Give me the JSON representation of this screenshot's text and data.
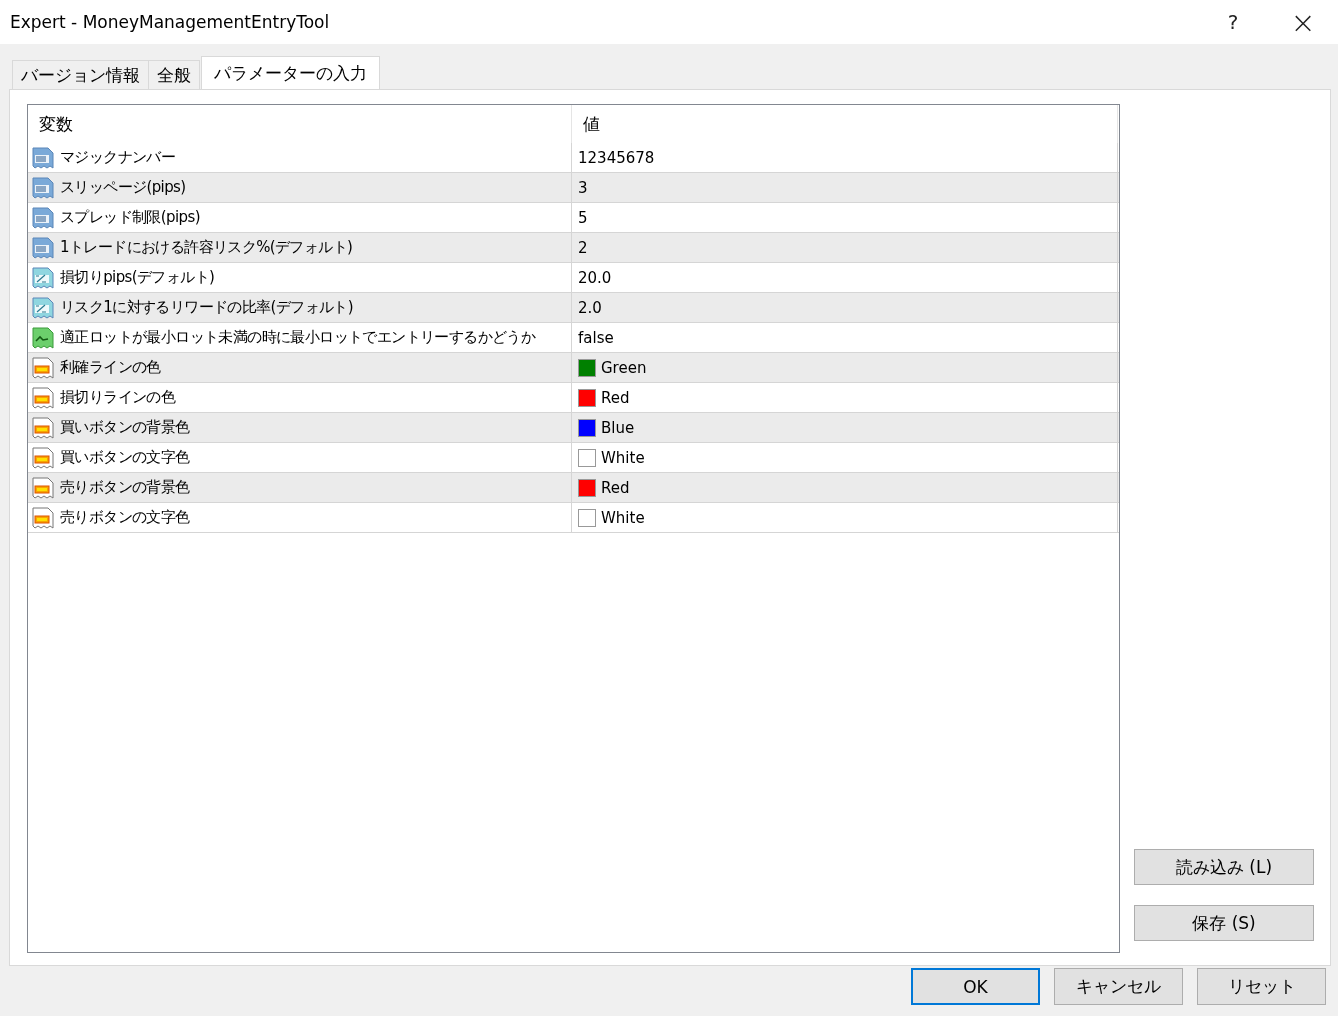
{
  "window": {
    "title": "Expert - MoneyManagementEntryTool",
    "help": "?",
    "close": "×"
  },
  "tabs": [
    {
      "label": "バージョン情報",
      "selected": false
    },
    {
      "label": "全般",
      "selected": false
    },
    {
      "label": "パラメーターの入力",
      "selected": true
    }
  ],
  "table": {
    "columns": [
      "変数",
      "値"
    ],
    "rows": [
      {
        "kind": "int",
        "name": "マジックナンバー",
        "value": "12345678"
      },
      {
        "kind": "int",
        "name": "スリッページ(pips)",
        "value": "3"
      },
      {
        "kind": "int",
        "name": "スプレッド制限(pips)",
        "value": "5"
      },
      {
        "kind": "int",
        "name": "1トレードにおける許容リスク%(デフォルト)",
        "value": "2"
      },
      {
        "kind": "double",
        "name": "損切りpips(デフォルト)",
        "value": "20.0"
      },
      {
        "kind": "double",
        "name": "リスク1に対するリワードの比率(デフォルト)",
        "value": "2.0"
      },
      {
        "kind": "bool",
        "name": "適正ロットが最小ロット未満の時に最小ロットでエントリーするかどうか",
        "value": "false"
      },
      {
        "kind": "color",
        "name": "利確ラインの色",
        "value": "Green",
        "color": "#008000"
      },
      {
        "kind": "color",
        "name": "損切りラインの色",
        "value": "Red",
        "color": "#ff0000"
      },
      {
        "kind": "color",
        "name": "買いボタンの背景色",
        "value": "Blue",
        "color": "#0000ff"
      },
      {
        "kind": "color",
        "name": "買いボタンの文字色",
        "value": "White",
        "color": "#ffffff"
      },
      {
        "kind": "color",
        "name": "売りボタンの背景色",
        "value": "Red",
        "color": "#ff0000"
      },
      {
        "kind": "color",
        "name": "売りボタンの文字色",
        "value": "White",
        "color": "#ffffff"
      }
    ]
  },
  "side_buttons": [
    "読み込み (L)",
    "保存 (S)"
  ],
  "buttons": [
    {
      "label": "OK",
      "default": true
    },
    {
      "label": "キャンセル",
      "default": false
    },
    {
      "label": "リセット",
      "default": false
    }
  ]
}
